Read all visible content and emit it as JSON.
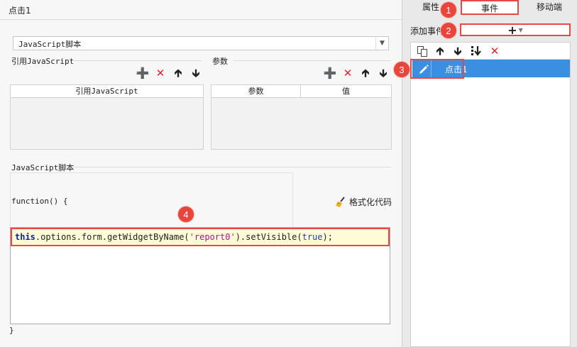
{
  "dialog": {
    "title": "点击1"
  },
  "type_select": {
    "value": "JavaScript脚本"
  },
  "ref_js": {
    "group_label": "引用JavaScript",
    "column": "引用JavaScript"
  },
  "params": {
    "group_label": "参数",
    "columns": [
      "参数",
      "值"
    ]
  },
  "toolbar_icons": [
    "plus-icon",
    "delete-x-icon",
    "arrow-up-icon",
    "arrow-down-icon"
  ],
  "script": {
    "group_label": "JavaScript脚本",
    "function_open": "function() {",
    "function_close": "}",
    "code": {
      "kw": "this",
      "part1": ".options.form.getWidgetByName(",
      "str": "'report0'",
      "part2": ").setVisible(",
      "val": "true",
      "part3": ");"
    },
    "format_label": "格式化代码"
  },
  "right": {
    "tabs": [
      "属性",
      "事件",
      "移动端"
    ],
    "active_tab": "事件",
    "add_event_label": "添加事件",
    "add_button_glyph": "+",
    "event_items": [
      {
        "label": "点击1"
      }
    ]
  },
  "badges": [
    "1",
    "2",
    "3",
    "4"
  ],
  "colors": {
    "highlight": "#e84848",
    "selected": "#3b8fe0",
    "delete": "#e8202a"
  }
}
